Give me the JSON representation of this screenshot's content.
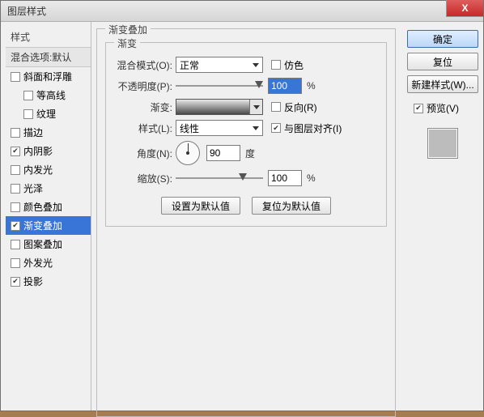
{
  "title": "图层样式",
  "left": {
    "styles_label": "样式",
    "blend_opts": "混合选项:默认",
    "items": [
      {
        "label": "斜面和浮雕",
        "checked": false,
        "indent": 0
      },
      {
        "label": "等高线",
        "checked": false,
        "indent": 1
      },
      {
        "label": "纹理",
        "checked": false,
        "indent": 1
      },
      {
        "label": "描边",
        "checked": false,
        "indent": 0
      },
      {
        "label": "内阴影",
        "checked": true,
        "indent": 0
      },
      {
        "label": "内发光",
        "checked": false,
        "indent": 0
      },
      {
        "label": "光泽",
        "checked": false,
        "indent": 0
      },
      {
        "label": "颜色叠加",
        "checked": false,
        "indent": 0
      },
      {
        "label": "渐变叠加",
        "checked": true,
        "indent": 0,
        "selected": true
      },
      {
        "label": "图案叠加",
        "checked": false,
        "indent": 0
      },
      {
        "label": "外发光",
        "checked": false,
        "indent": 0
      },
      {
        "label": "投影",
        "checked": true,
        "indent": 0
      }
    ]
  },
  "group": {
    "title": "渐变叠加",
    "inner_title": "渐变",
    "blend_mode": {
      "label": "混合模式(O):",
      "value": "正常",
      "dither": "仿色"
    },
    "opacity": {
      "label": "不透明度(P):",
      "value": "100",
      "pct": "%"
    },
    "gradient": {
      "label": "渐变:",
      "reverse": "反向(R)"
    },
    "style": {
      "label": "样式(L):",
      "value": "线性",
      "align": "与图层对齐(I)"
    },
    "angle": {
      "label": "角度(N):",
      "value": "90",
      "unit": "度"
    },
    "scale": {
      "label": "缩放(S):",
      "value": "100",
      "pct": "%"
    },
    "btn_default": "设置为默认值",
    "btn_reset": "复位为默认值"
  },
  "right": {
    "ok": "确定",
    "cancel": "复位",
    "new_style": "新建样式(W)...",
    "preview": "预览(V)"
  }
}
